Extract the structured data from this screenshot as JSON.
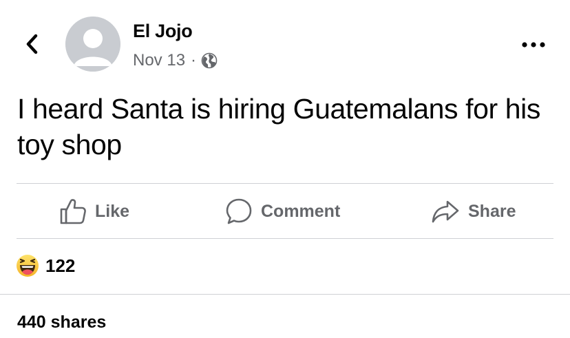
{
  "post": {
    "author": "El Jojo",
    "date": "Nov 13",
    "separator": "·",
    "text": "I heard Santa is hiring Guatemalans for his toy shop"
  },
  "actions": {
    "like": "Like",
    "comment": "Comment",
    "share": "Share"
  },
  "reactions": {
    "type": "haha",
    "count": "122"
  },
  "shares": "440 shares",
  "icons": {
    "back": "back-chevron-icon",
    "more": "more-options-icon",
    "privacy": "globe-icon",
    "like": "thumbs-up-icon",
    "comment": "comment-bubble-icon",
    "share": "share-arrow-icon",
    "reaction": "haha-emoji-icon"
  },
  "colors": {
    "text": "#050505",
    "secondary": "#65676b",
    "divider": "#ced0d4",
    "avatar_bg": "#c9ccd1",
    "emoji_yellow": "#f7c342"
  }
}
